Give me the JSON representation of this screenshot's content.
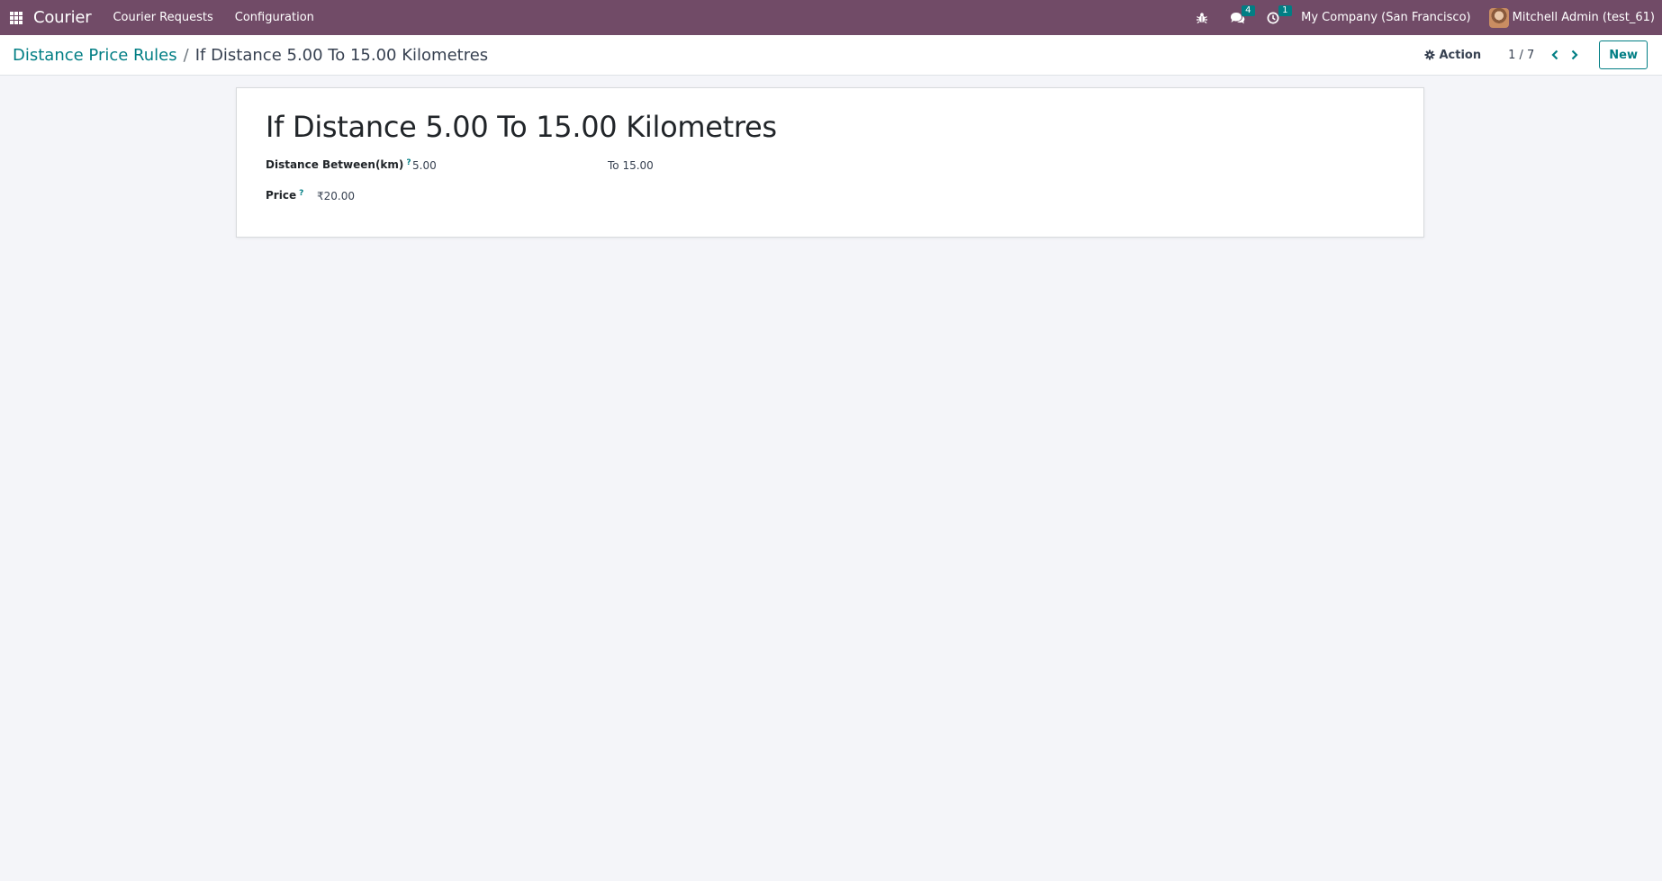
{
  "navbar": {
    "app_name": "Courier",
    "menus": [
      "Courier Requests",
      "Configuration"
    ],
    "messages_count": "4",
    "activities_count": "1",
    "company": "My Company (San Francisco)",
    "user": "Mitchell Admin (test_61)",
    "bg_color": "#714b67",
    "icons": [
      "apps-grid-icon",
      "bug-icon",
      "chat-icon",
      "clock-icon"
    ]
  },
  "control_panel": {
    "breadcrumb_parent": "Distance Price Rules",
    "breadcrumb_separator": "/",
    "breadcrumb_current": "If Distance 5.00 To 15.00 Kilometres",
    "action_label": "Action",
    "pager": "1 / 7",
    "new_label": "New",
    "accent_color": "#017e84"
  },
  "form": {
    "title": "If Distance 5.00 To 15.00 Kilometres",
    "distance_label": "Distance Between(km)",
    "distance_from": "5.00",
    "distance_to": "To 15.00",
    "price_label": "Price",
    "price_value": "₹20.00",
    "help_marker": "?"
  }
}
